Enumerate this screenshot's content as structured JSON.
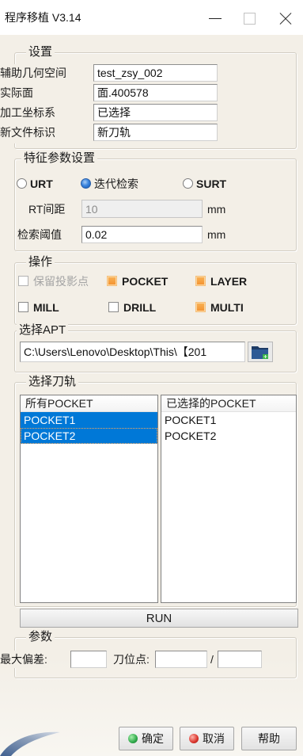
{
  "window": {
    "title": "程序移植 V3.14",
    "icons": {
      "minimize": "minimize-icon",
      "maximize": "maximize-icon",
      "close": "close-icon"
    }
  },
  "settings": {
    "legend": "设置",
    "fields": [
      {
        "label": "辅助几何空间",
        "value": "test_zsy_002"
      },
      {
        "label": "实际面",
        "value": "面.400578"
      },
      {
        "label": "加工坐标系",
        "value": "已选择"
      },
      {
        "label": "新文件标识",
        "value": "新刀轨"
      }
    ]
  },
  "feature_params": {
    "legend": "特征参数设置",
    "radios": [
      {
        "label": "URT",
        "checked": false
      },
      {
        "label": "迭代检索",
        "checked": true
      },
      {
        "label": "SURT",
        "checked": false
      }
    ],
    "rt_spacing": {
      "label": "RT间距",
      "value": "10",
      "unit": "mm",
      "disabled": true
    },
    "search_threshold": {
      "label": "检索阈值",
      "value": "0.02",
      "unit": "mm",
      "disabled": false
    }
  },
  "operations": {
    "legend": "操作",
    "options": [
      {
        "label": "保留投影点",
        "checked": false,
        "disabled": true
      },
      {
        "label": "POCKET",
        "checked": true,
        "disabled": false
      },
      {
        "label": "LAYER",
        "checked": true,
        "disabled": false
      },
      {
        "label": "MILL",
        "checked": false,
        "disabled": false
      },
      {
        "label": "DRILL",
        "checked": false,
        "disabled": false
      },
      {
        "label": "MULTI",
        "checked": true,
        "disabled": false
      }
    ]
  },
  "apt": {
    "legend": "选择APT",
    "path": "C:\\Users\\Lenovo\\Desktop\\This\\【201",
    "browse_icon": "folder-open-icon"
  },
  "toolpaths": {
    "legend": "选择刀轨",
    "available": {
      "header": "所有POCKET",
      "items": [
        {
          "label": "POCKET1",
          "selected": true,
          "focused": false
        },
        {
          "label": "POCKET2",
          "selected": true,
          "focused": true
        }
      ]
    },
    "chosen": {
      "header": "已选择的POCKET",
      "items": [
        {
          "label": "POCKET1"
        },
        {
          "label": "POCKET2"
        }
      ]
    }
  },
  "run": {
    "label": "RUN"
  },
  "params": {
    "legend": "参数",
    "max_deviation": {
      "label": "最大偏差:",
      "value": ""
    },
    "tool_points": {
      "label": "刀位点:",
      "value": "",
      "separator": "/",
      "total": ""
    }
  },
  "footer": {
    "ok": {
      "label": "确定",
      "icon": "green-dot-icon"
    },
    "cancel": {
      "label": "取消",
      "icon": "red-dot-icon"
    },
    "help": {
      "label": "帮助"
    }
  },
  "colors": {
    "background": "#f3efe7",
    "selection": "#0078d7",
    "checkbox_checked": "#f3922f",
    "radio_checked": "#1f66c1",
    "ok_icon": "#2ea84a",
    "cancel_icon": "#d9332b"
  },
  "decor": {
    "logo_icon": "app-logo-swoosh-icon"
  }
}
